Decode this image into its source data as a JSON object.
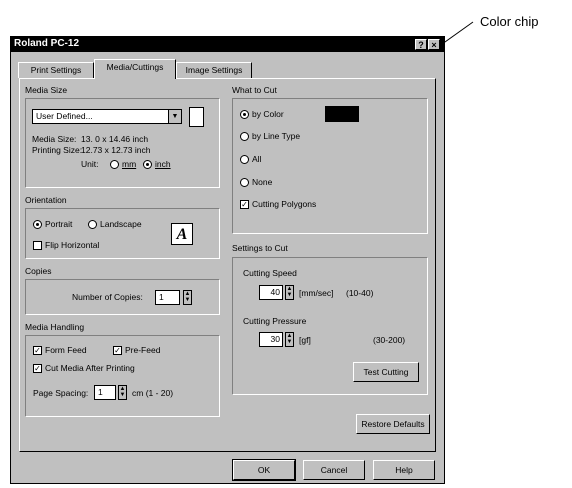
{
  "callout": {
    "label": "Color chip"
  },
  "window": {
    "title": "Roland PC-12",
    "help_label": "?",
    "close_label": "×"
  },
  "tabs": [
    "Print Settings",
    "Media/Cuttings",
    "Image Settings"
  ],
  "media_size": {
    "group_label": "Media Size",
    "dropdown_value": "User Defined...",
    "media_size_label": "Media Size:",
    "media_size_value": "13. 0 x 14.46 inch",
    "printing_size_label": "Printing Size:",
    "printing_size_value": "12.73 x 12.73 inch",
    "unit_label": "Unit:",
    "unit_options": [
      "mm",
      "inch"
    ],
    "unit_selected": "inch"
  },
  "orientation": {
    "group_label": "Orientation",
    "options": [
      "Portrait",
      "Landscape"
    ],
    "selected": "Portrait",
    "flip_label": "Flip Horizontal",
    "flip_checked": false,
    "preview_glyph": "A"
  },
  "copies": {
    "group_label": "Copies",
    "label": "Number of Copies:",
    "value": "1"
  },
  "media_handling": {
    "group_label": "Media Handling",
    "form_feed": "Form Feed",
    "pre_feed": "Pre-Feed",
    "cut_media": "Cut Media After Printing",
    "page_spacing_label": "Page Spacing:",
    "page_spacing_value": "1",
    "page_spacing_unit": "cm (1 - 20)"
  },
  "what_to_cut": {
    "group_label": "What to Cut",
    "options": [
      "by Color",
      "by Line Type",
      "All",
      "None"
    ],
    "selected": "by Color",
    "cutting_polygons": "Cutting Polygons",
    "cutting_polygons_checked": true,
    "chip_color": "#000000"
  },
  "settings_to_cut": {
    "group_label": "Settings to Cut",
    "speed_label": "Cutting Speed",
    "speed_value": "40",
    "speed_unit": "[mm/sec]",
    "speed_range": "(10-40)",
    "pressure_label": "Cutting Pressure",
    "pressure_value": "30",
    "pressure_unit": "[gf]",
    "pressure_range": "(30-200)",
    "test_button": "Test Cutting"
  },
  "restore_button": "Restore Defaults",
  "footer": {
    "ok": "OK",
    "cancel": "Cancel",
    "help": "Help"
  }
}
